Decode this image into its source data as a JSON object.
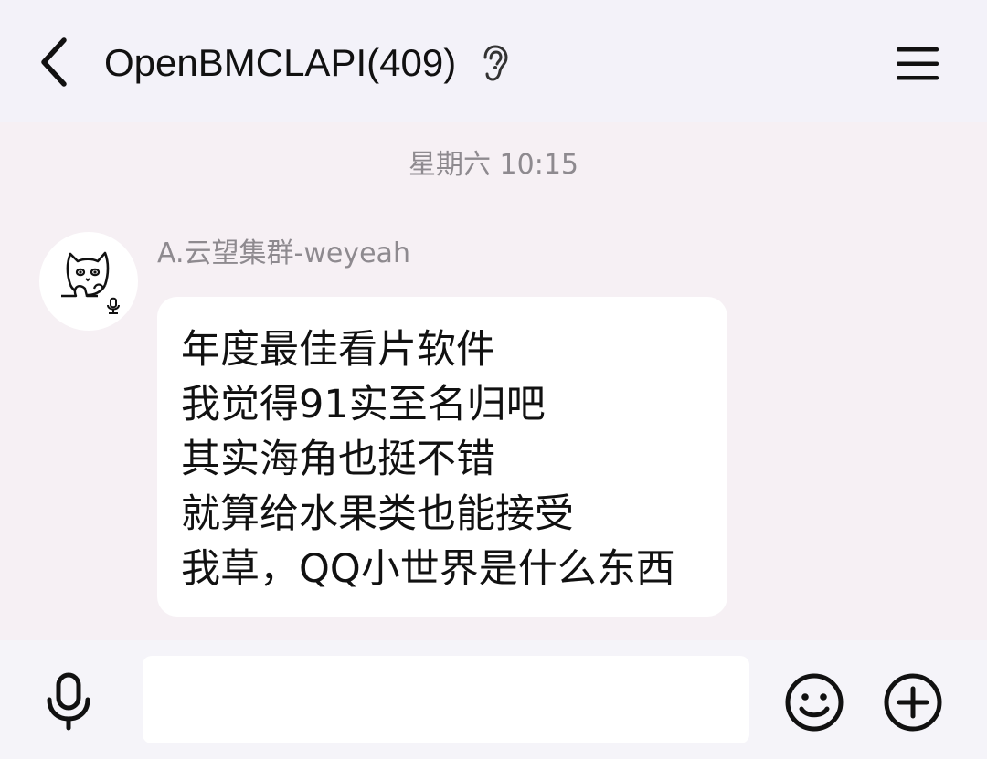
{
  "header": {
    "back_icon": "chevron-left-icon",
    "title": "OpenBMCLAPI(409)",
    "earpiece_icon": "ear-icon",
    "menu_icon": "hamburger-menu-icon"
  },
  "chat": {
    "timestamp": "星期六 10:15",
    "messages": [
      {
        "sender": "A.云望集群-weyeah",
        "avatar_icon": "cat-avatar",
        "lines": [
          "年度最佳看片软件",
          "我觉得91实至名归吧",
          "其实海角也挺不错",
          "就算给水果类也能接受",
          "我草，QQ小世界是什么东西"
        ]
      }
    ]
  },
  "input_bar": {
    "voice_icon": "microphone-icon",
    "text_value": "",
    "emoji_icon": "smiley-icon",
    "more_icon": "plus-circle-icon"
  },
  "colors": {
    "header_bg": "#f3f2f9",
    "chat_bg": "#f6f0f4",
    "bubble_bg": "#ffffff",
    "meta_text": "#8e8a8f"
  }
}
